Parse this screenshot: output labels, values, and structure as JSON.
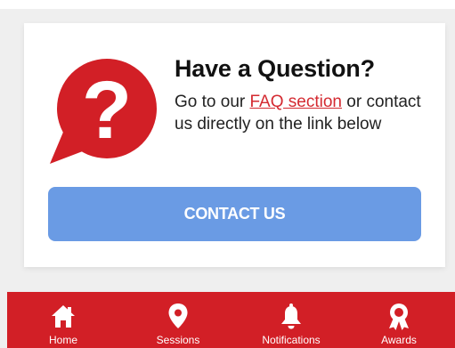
{
  "card": {
    "title": "Have a Question?",
    "body_prefix": "Go to our ",
    "faq_link_label": "FAQ section",
    "body_suffix": " or contact us directly on the link below",
    "contact_button_label": "CONTACT US"
  },
  "bottom_nav": {
    "items": [
      {
        "label": "Home",
        "icon": "home-icon"
      },
      {
        "label": "Sessions",
        "icon": "map-pin-icon"
      },
      {
        "label": "Notifications",
        "icon": "bell-icon"
      },
      {
        "label": "Awards",
        "icon": "award-icon"
      }
    ]
  },
  "colors": {
    "brand_red": "#d21f26",
    "button_blue": "#6a9be4",
    "link_red": "#d42a31"
  }
}
